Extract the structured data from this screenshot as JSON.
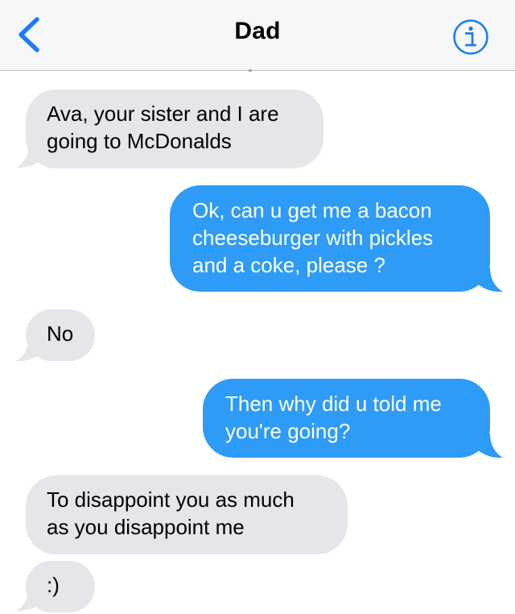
{
  "header": {
    "contact_name": "Dad",
    "back_icon": "chevron-left-icon",
    "info_icon": "info-circle-icon"
  },
  "colors": {
    "accent": "#1a7cf4",
    "incoming_bubble": "#e5e5ea",
    "outgoing_bubble": "#2e9bf6",
    "navbar_bg": "#f7f7f9"
  },
  "messages": [
    {
      "sender": "Dad",
      "direction": "incoming",
      "text": "Ava, your sister and I are\ngoing to McDonalds"
    },
    {
      "sender": "me",
      "direction": "outgoing",
      "text": "Ok, can u get me a bacon\ncheeseburger with pickles\nand a coke, please ?"
    },
    {
      "sender": "Dad",
      "direction": "incoming",
      "text": "No"
    },
    {
      "sender": "me",
      "direction": "outgoing",
      "text": "Then why did u told me\nyou're going?"
    },
    {
      "sender": "Dad",
      "direction": "incoming",
      "text": "To disappoint you as much\nas you disappoint me"
    },
    {
      "sender": "Dad",
      "direction": "incoming",
      "text": ":)"
    }
  ]
}
